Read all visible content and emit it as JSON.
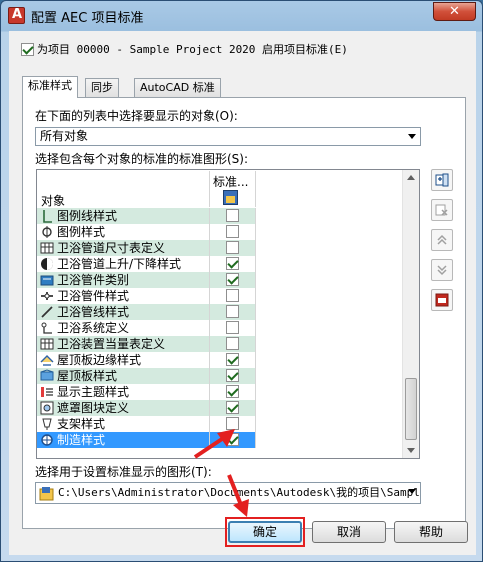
{
  "window": {
    "title": "配置 AEC 项目标准",
    "close_label": "✕"
  },
  "enable": {
    "label": "为项目 00000 - Sample Project 2020 启用项目标准(E)",
    "checked": true
  },
  "tabs": [
    {
      "label": "标准样式",
      "active": true
    },
    {
      "label": "同步",
      "active": false
    },
    {
      "label": "AutoCAD 标准",
      "active": false
    }
  ],
  "object_filter": {
    "label": "在下面的列表中选择要显示的对象(O):",
    "value": "所有对象"
  },
  "standards_list": {
    "label": "选择包含每个对象的标准的标准图形(S):",
    "col_object": "对象",
    "col_standard": "标准..."
  },
  "rows": [
    {
      "name": "图例线样式",
      "icon": "legend-line-icon",
      "checked": false,
      "tint": true
    },
    {
      "name": "图例样式",
      "icon": "legend-icon",
      "checked": false,
      "tint": false
    },
    {
      "name": "卫浴管道尺寸表定义",
      "icon": "table-icon",
      "checked": false,
      "tint": true
    },
    {
      "name": "卫浴管道上升/下降样式",
      "icon": "rise-drop-icon",
      "checked": true,
      "tint": false
    },
    {
      "name": "卫浴管件类别",
      "icon": "fitting-class-icon",
      "checked": true,
      "tint": true
    },
    {
      "name": "卫浴管件样式",
      "icon": "fitting-icon",
      "checked": false,
      "tint": false
    },
    {
      "name": "卫浴管线样式",
      "icon": "pipe-line-icon",
      "checked": false,
      "tint": true
    },
    {
      "name": "卫浴系统定义",
      "icon": "system-icon",
      "checked": false,
      "tint": false
    },
    {
      "name": "卫浴装置当量表定义",
      "icon": "table-icon",
      "checked": false,
      "tint": true
    },
    {
      "name": "屋顶板边缘样式",
      "icon": "roof-edge-icon",
      "checked": true,
      "tint": false
    },
    {
      "name": "屋顶板样式",
      "icon": "roof-slab-icon",
      "checked": true,
      "tint": true
    },
    {
      "name": "显示主题样式",
      "icon": "display-theme-icon",
      "checked": true,
      "tint": false
    },
    {
      "name": "遮罩图块定义",
      "icon": "mask-block-icon",
      "checked": true,
      "tint": true
    },
    {
      "name": "支架样式",
      "icon": "bracket-icon",
      "checked": false,
      "tint": false
    },
    {
      "name": "制造样式",
      "icon": "fabrication-icon",
      "checked": true,
      "tint": false,
      "selected": true
    }
  ],
  "path": {
    "label": "选择用于设置标准显示的图形(T):",
    "value": "C:\\Users\\Administrator\\Documents\\Autodesk\\我的项目\\Sample"
  },
  "buttons": {
    "ok": "确定",
    "cancel": "取消",
    "help": "帮助"
  },
  "side_tools": [
    {
      "icon": "add-drawing-icon"
    },
    {
      "icon": "remove-drawing-icon"
    },
    {
      "icon": "move-up-icon"
    },
    {
      "icon": "move-down-icon"
    },
    {
      "icon": "version-report-icon"
    }
  ],
  "colors": {
    "selection": "#3399ff",
    "row_tint": "#d4eadf",
    "annotation": "#e32020"
  }
}
